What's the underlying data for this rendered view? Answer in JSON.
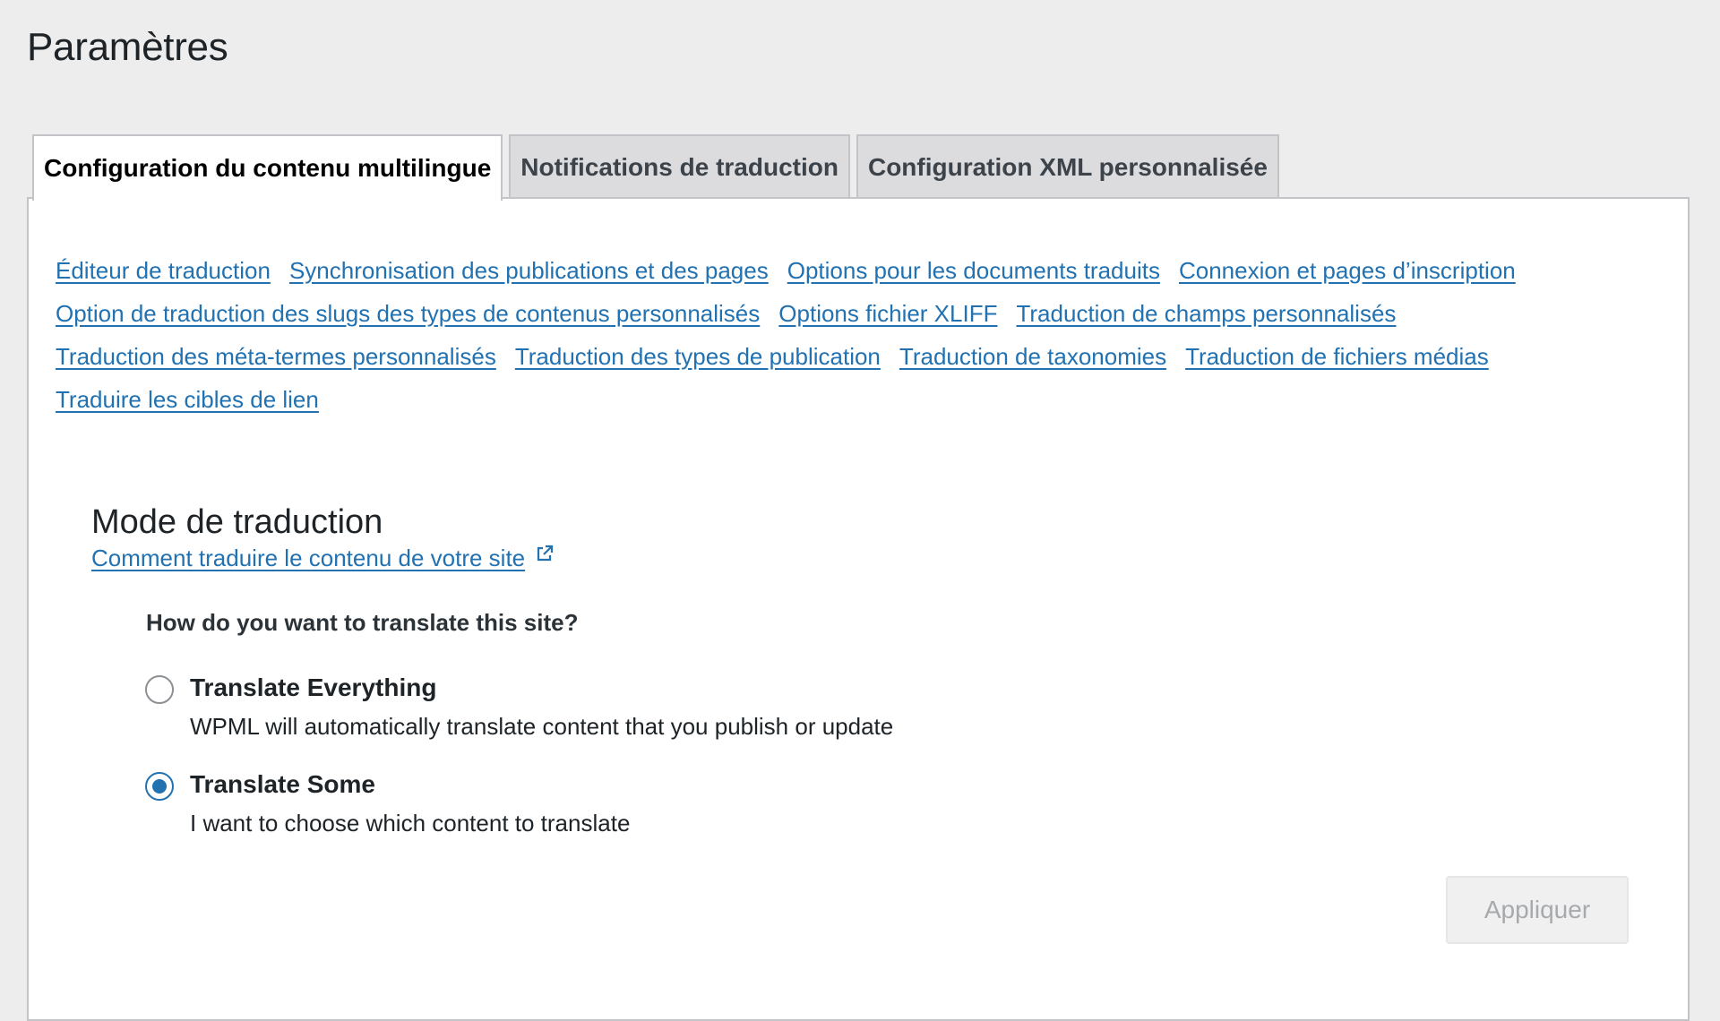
{
  "page": {
    "title": "Paramètres"
  },
  "tabs": [
    {
      "label": "Configuration du contenu multilingue",
      "active": true
    },
    {
      "label": "Notifications de traduction",
      "active": false
    },
    {
      "label": "Configuration XML personnalisée",
      "active": false
    }
  ],
  "links": [
    "Éditeur de traduction",
    "Synchronisation des publications et des pages",
    "Options pour les documents traduits",
    "Connexion et pages d’inscription",
    "Option de traduction des slugs des types de contenus personnalisés",
    "Options fichier XLIFF",
    "Traduction de champs personnalisés",
    "Traduction des méta-termes personnalisés",
    "Traduction des types de publication",
    "Traduction de taxonomies",
    "Traduction de fichiers médias",
    "Traduire les cibles de lien"
  ],
  "translation_mode": {
    "title": "Mode de traduction",
    "help_link": "Comment traduire le contenu de votre site",
    "help_icon": "external-link-icon",
    "question": "How do you want to translate this site?",
    "options": [
      {
        "label": "Translate Everything",
        "description": "WPML will automatically translate content that you publish or update",
        "selected": false
      },
      {
        "label": "Translate Some",
        "description": "I want to choose which content to translate",
        "selected": true
      }
    ],
    "apply_label": "Appliquer"
  },
  "colors": {
    "link": "#2271b1",
    "background": "#ededed",
    "panel": "#ffffff",
    "radio_checked": "#2271b1"
  }
}
